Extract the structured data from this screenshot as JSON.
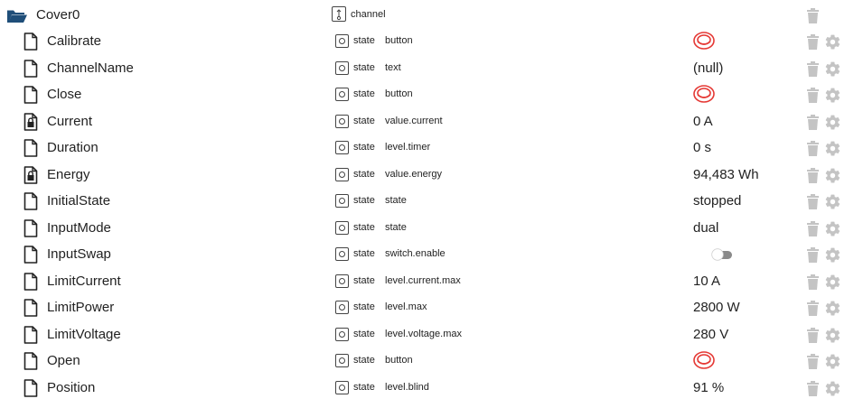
{
  "channel": {
    "name": "Cover0",
    "type": "channel"
  },
  "states": [
    {
      "name": "Calibrate",
      "type": "state",
      "role": "button",
      "value": null,
      "kind": "button",
      "locked": false
    },
    {
      "name": "ChannelName",
      "type": "state",
      "role": "text",
      "value": "(null)",
      "kind": "text",
      "locked": false
    },
    {
      "name": "Close",
      "type": "state",
      "role": "button",
      "value": null,
      "kind": "button",
      "locked": false
    },
    {
      "name": "Current",
      "type": "state",
      "role": "value.current",
      "value": "0 A",
      "kind": "text",
      "locked": true
    },
    {
      "name": "Duration",
      "type": "state",
      "role": "level.timer",
      "value": "0 s",
      "kind": "text",
      "locked": false
    },
    {
      "name": "Energy",
      "type": "state",
      "role": "value.energy",
      "value": "94,483 Wh",
      "kind": "text",
      "locked": true
    },
    {
      "name": "InitialState",
      "type": "state",
      "role": "state",
      "value": "stopped",
      "kind": "text",
      "locked": false
    },
    {
      "name": "InputMode",
      "type": "state",
      "role": "state",
      "value": "dual",
      "kind": "text",
      "locked": false
    },
    {
      "name": "InputSwap",
      "type": "state",
      "role": "switch.enable",
      "value": false,
      "kind": "toggle",
      "locked": false
    },
    {
      "name": "LimitCurrent",
      "type": "state",
      "role": "level.current.max",
      "value": "10 A",
      "kind": "text",
      "locked": false
    },
    {
      "name": "LimitPower",
      "type": "state",
      "role": "level.max",
      "value": "2800 W",
      "kind": "text",
      "locked": false
    },
    {
      "name": "LimitVoltage",
      "type": "state",
      "role": "level.voltage.max",
      "value": "280 V",
      "kind": "text",
      "locked": false
    },
    {
      "name": "Open",
      "type": "state",
      "role": "button",
      "value": null,
      "kind": "button",
      "locked": false
    },
    {
      "name": "Position",
      "type": "state",
      "role": "level.blind",
      "value": "91 %",
      "kind": "text",
      "locked": false
    }
  ],
  "colors": {
    "folder": "#1f4e79",
    "button_red": "#e53935",
    "action_gray": "#c4c4c4",
    "toggle_track": "#8a8a8a",
    "toggle_knob": "#ffffff"
  },
  "icons": {
    "folder": "folder-open-icon",
    "file": "file-icon",
    "locked_file": "locked-file-icon",
    "delete": "trash-icon",
    "settings": "gear-icon",
    "channel_type": "channel-type-icon",
    "state_type": "state-type-icon",
    "button": "push-button-icon"
  }
}
